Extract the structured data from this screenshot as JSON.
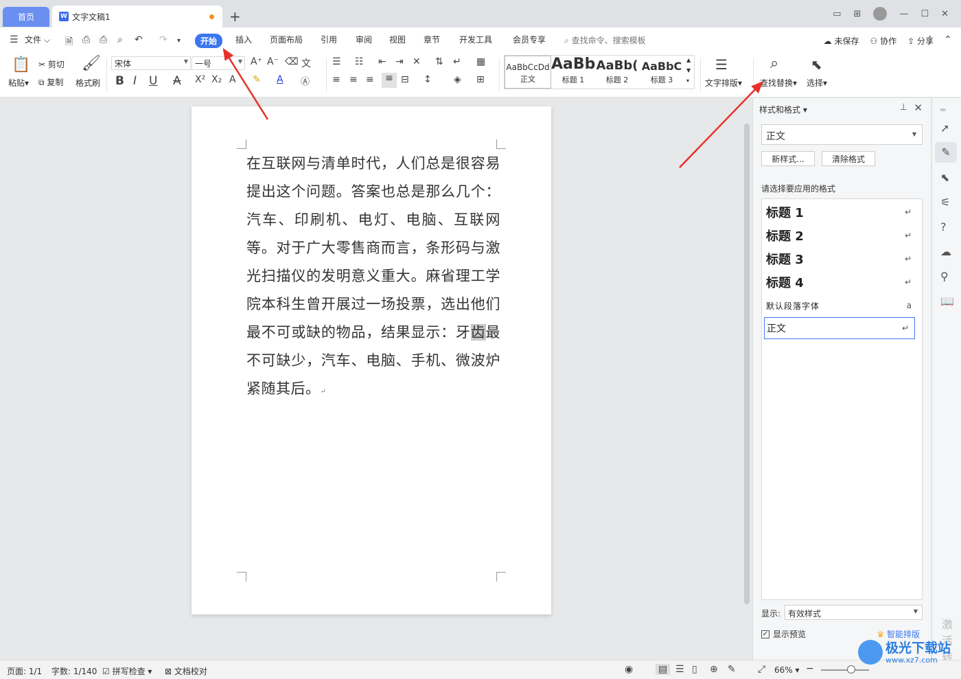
{
  "tabs": {
    "home": "首页",
    "doc_title": "文字文稿1",
    "new_tab": "+"
  },
  "menu": {
    "file": "文件",
    "items": [
      "开始",
      "插入",
      "页面布局",
      "引用",
      "审阅",
      "视图",
      "章节",
      "开发工具",
      "会员专享"
    ],
    "active": "开始",
    "search_placeholder": "查找命令、搜索模板",
    "unsaved": "未保存",
    "collab": "协作",
    "share": "分享"
  },
  "ribbon": {
    "paste": "粘贴",
    "cut": "剪切",
    "copy": "复制",
    "format_painter": "格式刷",
    "font_name": "宋体",
    "font_size": "一号",
    "styles": [
      {
        "preview": "AaBbCcDd",
        "label": "正文"
      },
      {
        "preview": "AaBb",
        "label": "标题 1"
      },
      {
        "preview": "AaBb(",
        "label": "标题 2"
      },
      {
        "preview": "AaBbC",
        "label": "标题 3"
      }
    ],
    "text_layout": "文字排版",
    "find_replace": "查找替换",
    "select": "选择"
  },
  "document": {
    "before": "在互联网与清单时代，人们总是很容易提出这个问题。答案也总是那么几个：汽车、印刷机、电灯、电脑、互联网等。对于广大零售商而言，条形码与激光扫描仪的发明意义重大。麻省理工学院本科生曾开展过一场投票，选出他们最不可或缺的物品，结果显示：牙",
    "highlighted": "齿",
    "after": "最不可缺少，汽车、电脑、手机、微波炉紧随其后。",
    "para_mark": "↵"
  },
  "panel": {
    "title": "样式和格式",
    "current_style": "正文",
    "new_style": "新样式...",
    "clear_format": "清除格式",
    "prompt": "请选择要应用的格式",
    "items": [
      {
        "name": "标题  1",
        "mark": "↵"
      },
      {
        "name": "标题  2",
        "mark": "↵"
      },
      {
        "name": "标题  3",
        "mark": "↵"
      },
      {
        "name": "标题  4",
        "mark": "↵"
      },
      {
        "name": "默认段落字体",
        "mark": "a"
      },
      {
        "name": "正文",
        "mark": "↵"
      }
    ],
    "selected_index": 5,
    "show_label": "显示:",
    "show_value": "有效样式",
    "preview_label": "显示预览",
    "preview_checked": true,
    "smart_layout": "智能排版"
  },
  "status": {
    "page": "页面: 1/1",
    "word_count": "字数: 1/140",
    "spell_check": "拼写检查",
    "doc_proof": "文档校对",
    "zoom": "66%"
  },
  "watermark": {
    "side_1": "激活",
    "side_2": "转到",
    "logo_main": "极光下载站",
    "logo_url": "www.xz7.com"
  },
  "colors": {
    "accent": "#3b76f0",
    "home_tab": "#6b8ff0",
    "annotation_arrow": "#e8302a",
    "unsaved_dot": "#f5901e"
  }
}
